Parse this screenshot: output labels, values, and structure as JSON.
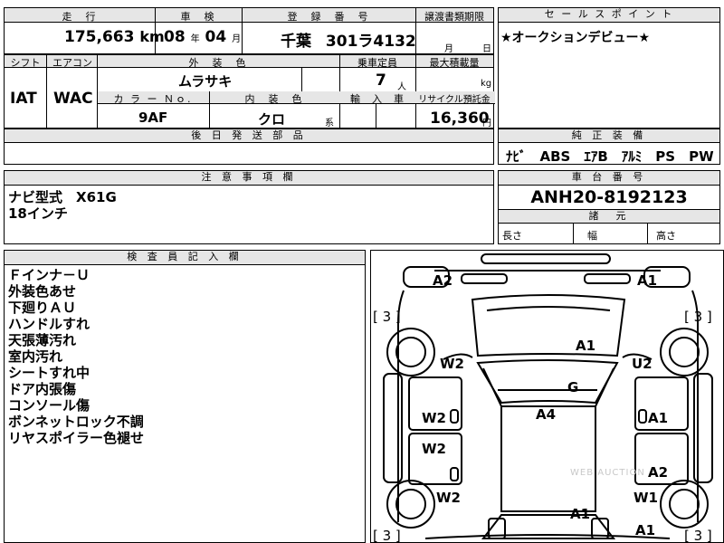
{
  "top_row": {
    "headers": {
      "mileage": "走　行",
      "inspection": "車　検",
      "registration": "登　録　番　号",
      "transfer_docs": "譲渡書類期限",
      "sales_point": "セ ー ル ス ポ イ ン ト"
    },
    "mileage_value": "175,663",
    "mileage_unit": "km",
    "inspection_year": "08",
    "inspection_year_unit": "年",
    "inspection_month": "04",
    "inspection_month_unit": "月",
    "plate_region": "千葉",
    "plate_number": "301ラ4132",
    "transfer_month_unit": "月",
    "transfer_day_unit": "日",
    "sales_point_text": "★オークションデビュー★"
  },
  "spec_row": {
    "headers": {
      "shift": "シフト",
      "aircon": "エアコン",
      "exterior_color": "外　装　色",
      "capacity": "乗車定員",
      "max_load": "最大積載量",
      "color_no": "カ ラ ー Ｎｏ.",
      "interior_color": "内　装　色",
      "import": "輸　入　車",
      "recycle": "リサイクル預託金"
    },
    "shift": "IAT",
    "aircon": "WAC",
    "exterior_color": "ムラサキ",
    "capacity": "7",
    "capacity_unit": "人",
    "max_load_unit": "kg",
    "color_no": "9AF",
    "interior_color": "クロ",
    "interior_suffix": "系",
    "recycle_fee": "16,360",
    "recycle_unit": "円",
    "later_parts_header": "後 日 発 送 部 品"
  },
  "equipment": {
    "header": "純 正 装 備",
    "items": "ﾅﾋﾞ　ABS　ｴｱB　ｱﾙﾐ　PS　PW"
  },
  "notes": {
    "header": "注 意 事 項 欄",
    "lines": [
      "ナビ型式　X61G",
      "18インチ"
    ]
  },
  "chassis": {
    "header": "車 台 番 号",
    "value": "ANH20-8192123",
    "dims_header": "諸　元",
    "length_label": "長さ",
    "width_label": "幅",
    "height_label": "高さ"
  },
  "inspector": {
    "header": "検 査 員 記 入 欄",
    "lines": [
      "Ｆインナ－Ｕ",
      "外装色あせ",
      "下廻りＡＵ",
      "ハンドルすれ",
      "天張薄汚れ",
      "室内汚れ",
      "シートすれ中",
      "ドア内張傷",
      "コンソール傷",
      "ボンネットロック不調",
      "リヤスポイラー色褪せ"
    ]
  },
  "diagram": {
    "marks": {
      "front_left_a2": "A2",
      "front_right_a1": "A1",
      "bracket_left_top": "[ 3 ]",
      "bracket_right_top": "[ 3 ]",
      "hood_a1": "A1",
      "left_fender_w2": "W2",
      "right_fender_u2": "U2",
      "windshield_g": "G",
      "roof_a4": "A4",
      "left_front_door_w2": "W2",
      "right_front_door_a1": "A1",
      "left_rear_door_w2": "W2",
      "right_rear_door_a2": "A2",
      "left_quarter_w2": "W2",
      "right_quarter_w1": "W1",
      "trunk_a1": "A1",
      "rear_right_a1": "A1",
      "bracket_left_bottom": "[ 3 ]",
      "bracket_right_bottom": "[ 3 ]"
    },
    "watermark": "WEB AUCTION"
  }
}
